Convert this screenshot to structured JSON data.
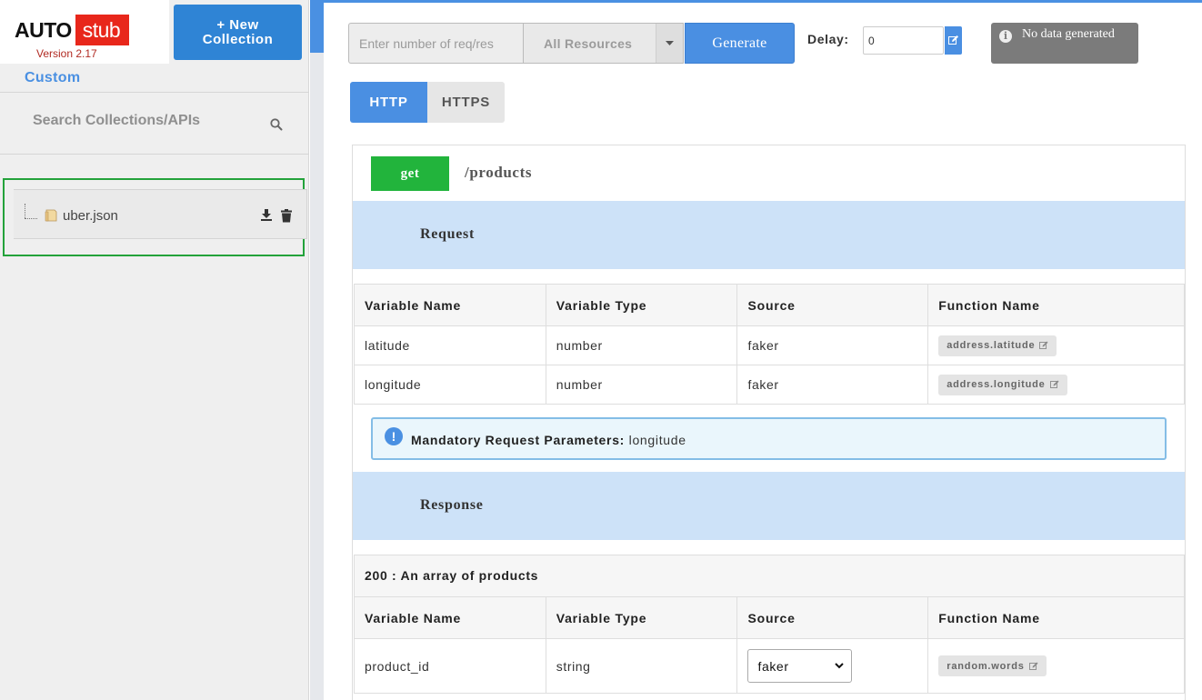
{
  "brand": {
    "logo_auto": "AUTO",
    "logo_stub": "stub",
    "version": "Version 2.17"
  },
  "sidebar": {
    "new_collection_line1": "+ New",
    "new_collection_line2": "Collection",
    "custom_label": "Custom",
    "search_placeholder": "Search Collections/APIs",
    "files": [
      {
        "name": "uber.json"
      }
    ]
  },
  "toolbar": {
    "req_placeholder": "Enter number of req/res",
    "resources_value": "All Resources",
    "generate_label": "Generate",
    "delay_label": "Delay:",
    "delay_value": "0",
    "status_message": "No data generated"
  },
  "tabs": [
    {
      "label": "HTTP",
      "active": true
    },
    {
      "label": "HTTPS",
      "active": false
    }
  ],
  "api": {
    "method": "get",
    "path": "/products",
    "request": {
      "section_title": "Request",
      "headers": [
        "Variable Name",
        "Variable Type",
        "Source",
        "Function Name"
      ],
      "rows": [
        {
          "name": "latitude",
          "type": "number",
          "source": "faker",
          "function": "address.latitude"
        },
        {
          "name": "longitude",
          "type": "number",
          "source": "faker",
          "function": "address.longitude"
        }
      ],
      "mandatory_label": "Mandatory Request Parameters:",
      "mandatory_value": "longitude"
    },
    "response": {
      "section_title": "Response",
      "status_line": "200 : An array of products",
      "headers": [
        "Variable Name",
        "Variable Type",
        "Source",
        "Function Name"
      ],
      "rows": [
        {
          "name": "product_id",
          "type": "string",
          "source": "faker",
          "function": "random.words"
        }
      ]
    }
  },
  "colors": {
    "accent": "#4a8fe2",
    "method_get": "#22b43c",
    "section_band": "#cde2f8",
    "highlight": "#23a23a",
    "logo_red": "#e8271b"
  }
}
